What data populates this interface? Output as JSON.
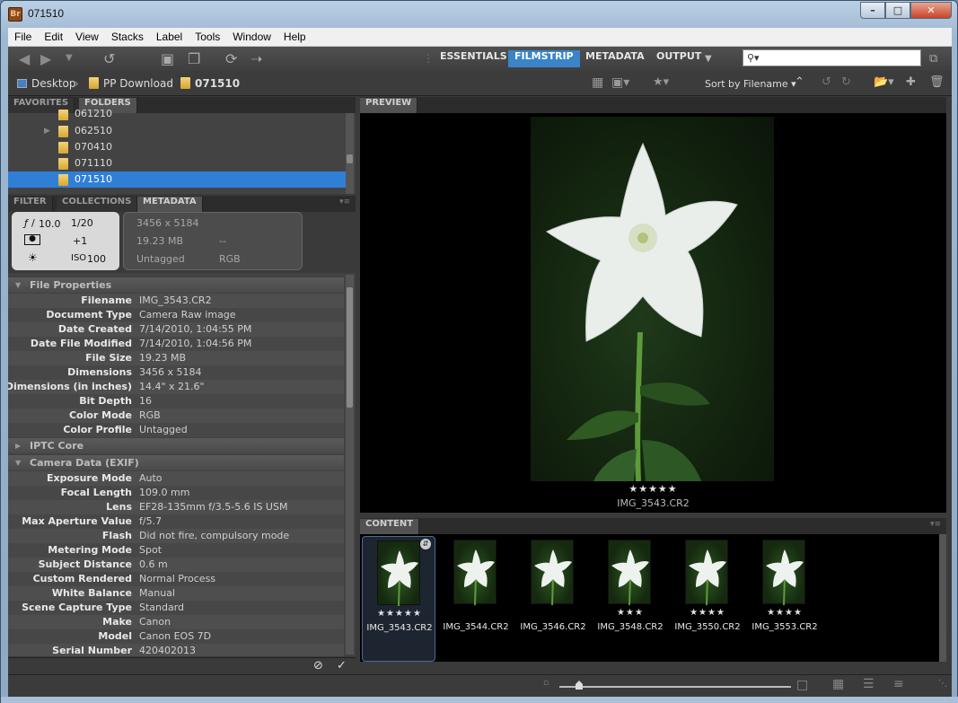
{
  "window": {
    "title": "071510",
    "app_icon": "Br"
  },
  "menu": [
    "File",
    "Edit",
    "View",
    "Stacks",
    "Label",
    "Tools",
    "Window",
    "Help"
  ],
  "workspaces": [
    {
      "label": "ESSENTIALS",
      "active": false
    },
    {
      "label": "FILMSTRIP",
      "active": true
    },
    {
      "label": "METADATA",
      "active": false
    },
    {
      "label": "OUTPUT",
      "active": false
    }
  ],
  "search": {
    "placeholder": ""
  },
  "path": [
    "Desktop",
    "PP Download",
    "071510"
  ],
  "sort_label": "Sort by Filename",
  "left_tabs_top": [
    "FAVORITES",
    "FOLDERS"
  ],
  "folders": [
    "061210",
    "062510",
    "070410",
    "071110",
    "071510"
  ],
  "selected_folder": "071510",
  "left_tabs_mid": [
    "FILTER",
    "COLLECTIONS",
    "METADATA"
  ],
  "summary": {
    "aperture": "10.0",
    "shutter": "1/20",
    "exposure_comp": "+1",
    "iso_label": "ISO",
    "iso": "100",
    "dimensions": "3456 x 5184",
    "size": "19.23 MB",
    "dash": "--",
    "tagged": "Untagged",
    "mode": "RGB"
  },
  "sections": {
    "file_properties": "File Properties",
    "iptc": "IPTC Core",
    "camera": "Camera Data (EXIF)"
  },
  "file_properties": [
    {
      "k": "Filename",
      "v": "IMG_3543.CR2"
    },
    {
      "k": "Document Type",
      "v": "Camera Raw image"
    },
    {
      "k": "Date Created",
      "v": "7/14/2010, 1:04:55 PM"
    },
    {
      "k": "Date File Modified",
      "v": "7/14/2010, 1:04:56 PM"
    },
    {
      "k": "File Size",
      "v": "19.23 MB"
    },
    {
      "k": "Dimensions",
      "v": "3456 x 5184"
    },
    {
      "k": "Dimensions (in inches)",
      "v": "14.4\" x 21.6\""
    },
    {
      "k": "Bit Depth",
      "v": "16"
    },
    {
      "k": "Color Mode",
      "v": "RGB"
    },
    {
      "k": "Color Profile",
      "v": "Untagged"
    }
  ],
  "camera_data": [
    {
      "k": "Exposure Mode",
      "v": "Auto"
    },
    {
      "k": "Focal Length",
      "v": "109.0 mm"
    },
    {
      "k": "Lens",
      "v": "EF28-135mm f/3.5-5.6 IS USM"
    },
    {
      "k": "Max Aperture Value",
      "v": "f/5.7"
    },
    {
      "k": "Flash",
      "v": "Did not fire, compulsory mode"
    },
    {
      "k": "Metering Mode",
      "v": "Spot"
    },
    {
      "k": "Subject Distance",
      "v": "0.6 m"
    },
    {
      "k": "Custom Rendered",
      "v": "Normal Process"
    },
    {
      "k": "White Balance",
      "v": "Manual"
    },
    {
      "k": "Scene Capture Type",
      "v": "Standard"
    },
    {
      "k": "Make",
      "v": "Canon"
    },
    {
      "k": "Model",
      "v": "Canon EOS 7D"
    },
    {
      "k": "Serial Number",
      "v": "420402013"
    }
  ],
  "preview": {
    "tab": "PREVIEW",
    "rating": "★★★★★",
    "filename": "IMG_3543.CR2"
  },
  "content": {
    "tab": "CONTENT",
    "items": [
      {
        "name": "IMG_3543.CR2",
        "stars": "★★★★★",
        "selected": true
      },
      {
        "name": "IMG_3544.CR2",
        "stars": "",
        "selected": false
      },
      {
        "name": "IMG_3546.CR2",
        "stars": "",
        "selected": false
      },
      {
        "name": "IMG_3548.CR2",
        "stars": "★★★",
        "selected": false
      },
      {
        "name": "IMG_3550.CR2",
        "stars": "★★★★",
        "selected": false
      },
      {
        "name": "IMG_3553.CR2",
        "stars": "★★★★",
        "selected": false
      }
    ]
  },
  "colors": {
    "accent": "#3a84c8",
    "selection": "#2f7fd6"
  }
}
